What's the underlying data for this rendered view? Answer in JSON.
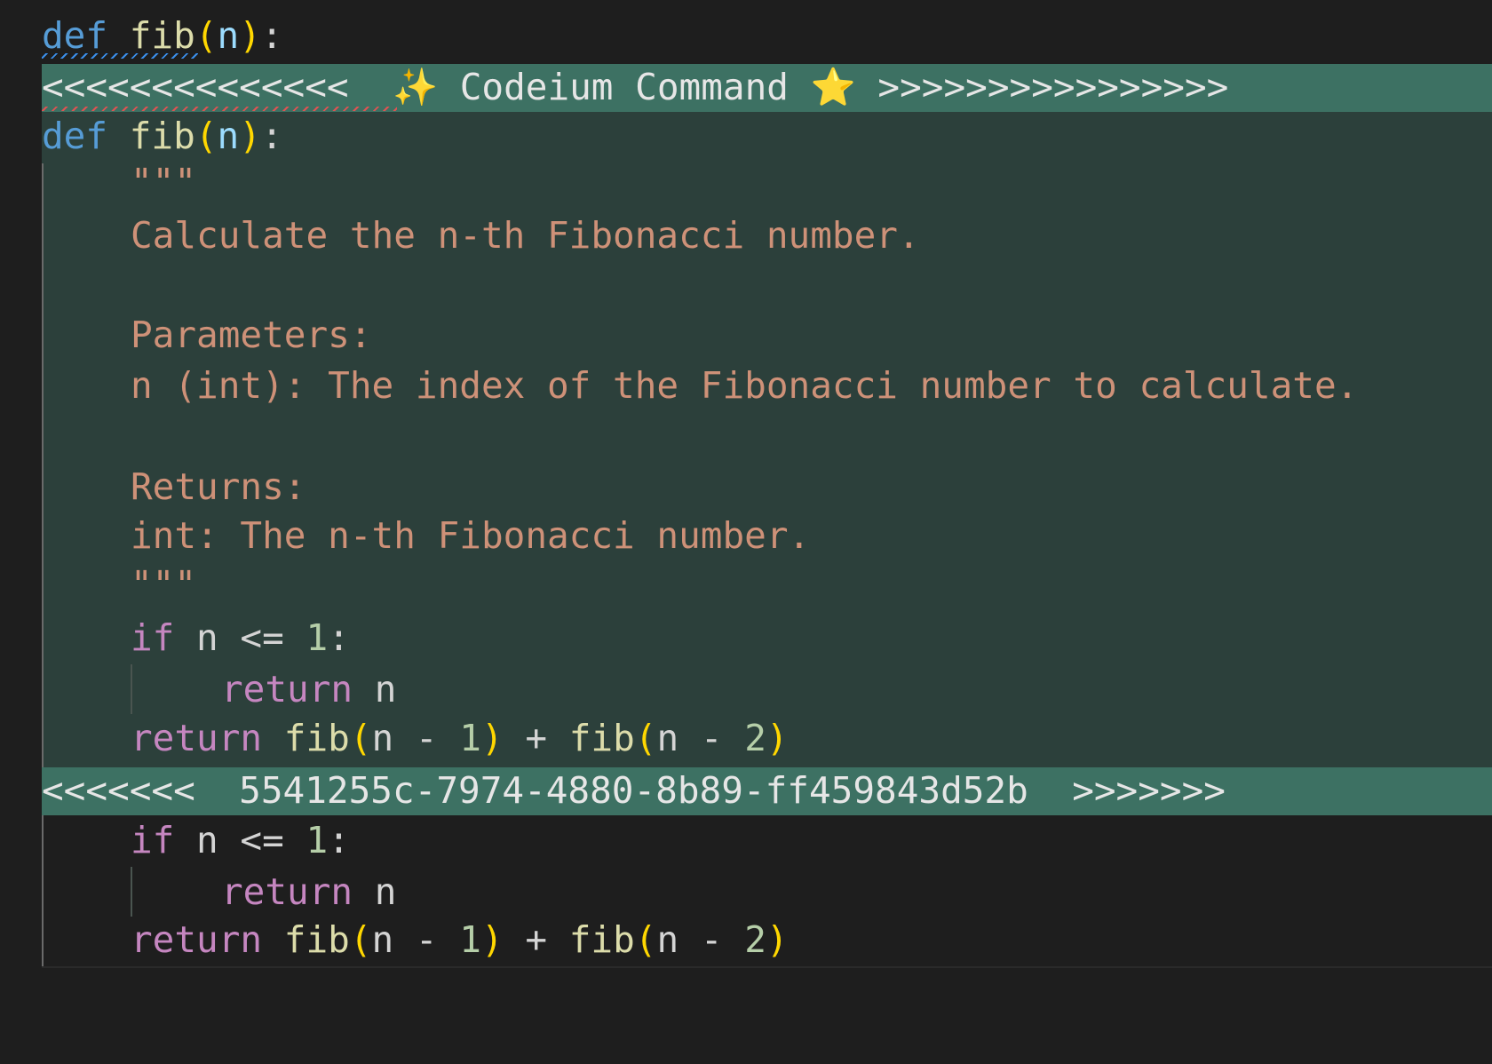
{
  "original": {
    "def_kw": "def",
    "fn_name": "fib",
    "open_paren": "(",
    "param": "n",
    "close_paren": ")",
    "colon": ":"
  },
  "command_marker": {
    "left_arrows": "<<<<<<<<<<<<<<",
    "sparkle": "✨",
    "label": "Codeium Command",
    "star": "⭐",
    "right_arrows": ">>>>>>>>>>>>>>>>"
  },
  "proposed": {
    "def_kw": "def",
    "fn_name": "fib",
    "open_paren": "(",
    "param": "n",
    "close_paren": ")",
    "colon": ":",
    "docstring": [
      "\"\"\"",
      "Calculate the n-th Fibonacci number.",
      "Parameters:",
      "n (int): The index of the Fibonacci number to calculate.",
      "Returns:",
      "int: The n-th Fibonacci number.",
      "\"\"\""
    ],
    "if_kw": "if",
    "if_rest": " n <= ",
    "if_num": "1",
    "if_colon": ":",
    "return_kw": "return",
    "return_n": " n",
    "ret2_kw": "return",
    "ret2_fn1": " fib",
    "ret2_p1": "(",
    "ret2_mid1": "n - ",
    "ret2_num1": "1",
    "ret2_p2": ")",
    "ret2_plus": " + ",
    "ret2_fn2": "fib",
    "ret2_p3": "(",
    "ret2_mid2": "n - ",
    "ret2_num2": "2",
    "ret2_p4": ")"
  },
  "id_marker": {
    "left_arrows": "<<<<<<<",
    "id": "5541255c-7974-4880-8b89-ff459843d52b",
    "right_arrows": ">>>>>>>"
  },
  "existing": {
    "if_kw": "if",
    "if_rest": " n <= ",
    "if_num": "1",
    "if_colon": ":",
    "return_kw": "return",
    "return_n": " n",
    "ret2_kw": "return",
    "ret2_fn1": " fib",
    "ret2_p1": "(",
    "ret2_mid1": "n - ",
    "ret2_num1": "1",
    "ret2_p2": ")",
    "ret2_plus": " + ",
    "ret2_fn2": "fib",
    "ret2_p3": "(",
    "ret2_mid2": "n - ",
    "ret2_num2": "2",
    "ret2_p4": ")"
  },
  "colors": {
    "editor_bg": "#1e1e1e",
    "proposed_bg": "#2c403b",
    "marker_bg": "#3d7163"
  }
}
